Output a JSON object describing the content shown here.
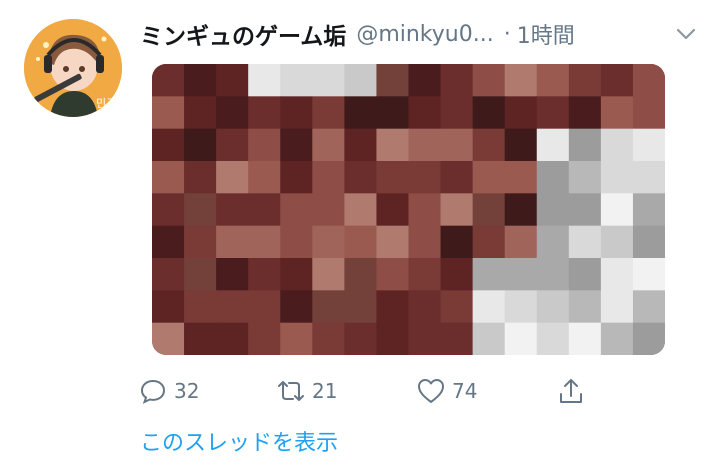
{
  "tweet": {
    "display_name": "ミンギュのゲーム垢",
    "handle": "@minkyu0...",
    "separator": "·",
    "timestamp": "1時間",
    "avatar_badge": "민규",
    "media": {
      "description_icon": "pixelated-image"
    },
    "actions": {
      "reply_count": "32",
      "retweet_count": "21",
      "like_count": "74"
    },
    "show_thread_label": "このスレッドを表示"
  },
  "colors": {
    "link": "#1da1f2",
    "secondary_text": "#657786",
    "primary_text": "#14171a"
  }
}
